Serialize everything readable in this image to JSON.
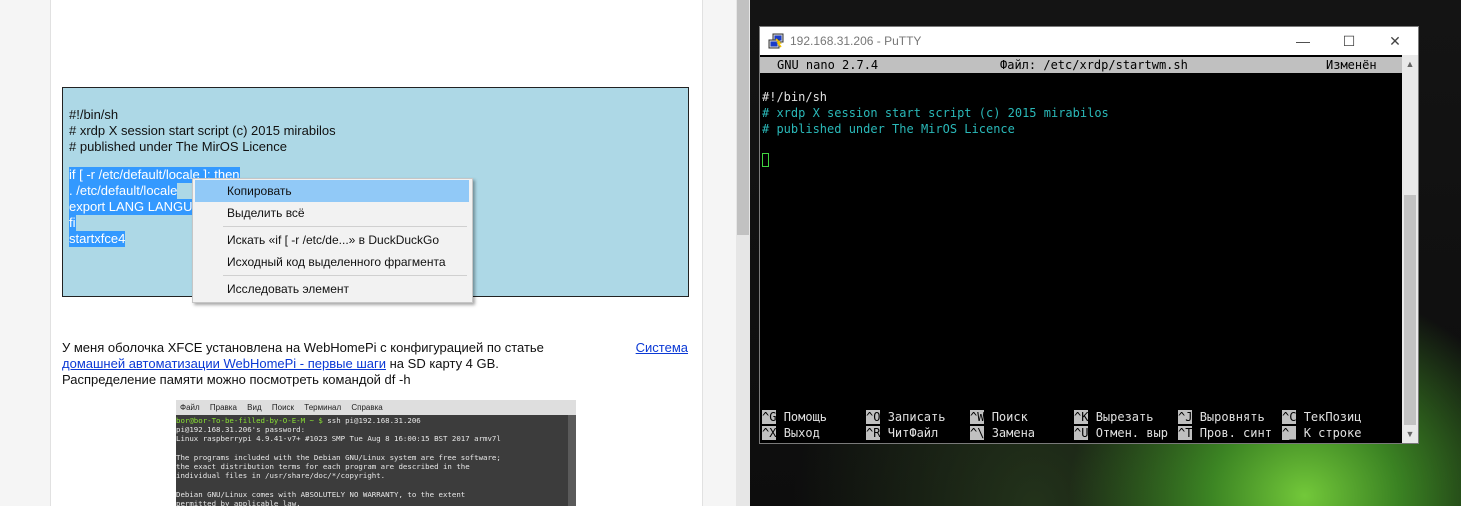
{
  "browser": {
    "code": {
      "lines": [
        "#!/bin/sh",
        "# xrdp X session start script (c) 2015 mirabilos",
        "# published under The MirOS Licence"
      ],
      "selected_lines": [
        "if [ -r /etc/default/locale ]; then",
        ". /etc/default/locale",
        "export LANG LANGUAGE",
        "fi",
        "startxfce4"
      ]
    },
    "context_menu": {
      "items": [
        "Копировать",
        "Выделить всё",
        "Искать «if [ -r /etc/de...» в DuckDuckGo",
        "Исходный код выделенного фрагмента",
        "Исследовать элемент"
      ]
    },
    "article": {
      "text1": "У меня оболочка XFCE установлена на WebHomePi с конфигурацией по статье",
      "link_a": "Система",
      "link_b": "домашней автоматизации WebHomePi - первые шаги",
      "text2": "на SD карту 4 GB.",
      "text3": "Распределение памяти можно посмотреть командой df -h"
    },
    "terminal_screenshot": {
      "menu": [
        "Файл",
        "Правка",
        "Вид",
        "Поиск",
        "Терминал",
        "Справка"
      ],
      "prompt": "bor@bor-To-be-filled-by-O-E-M ~ $",
      "command": "ssh pi@192.168.31.206",
      "lines": [
        "pi@192.168.31.206's password:",
        "Linux raspberrypi 4.9.41-v7+ #1023 SMP Tue Aug 8 16:00:15 BST 2017 armv7l",
        "",
        "The programs included with the Debian GNU/Linux system are free software;",
        "the exact distribution terms for each program are described in the",
        "individual files in /usr/share/doc/*/copyright.",
        "",
        "Debian GNU/Linux comes with ABSOLUTELY NO WARRANTY, to the extent",
        "permitted by applicable law."
      ]
    }
  },
  "putty": {
    "title": "192.168.31.206 - PuTTY",
    "buttons": {
      "minimize": "—",
      "maximize": "☐",
      "close": "✕"
    },
    "nano_header": {
      "app": "GNU nano 2.7.4",
      "file": "Файл: /etc/xrdp/startwm.sh",
      "status": "Изменён"
    },
    "file_lines": [
      "#!/bin/sh",
      "# xrdp X session start script (c) 2015 mirabilos",
      "# published under The MirOS Licence"
    ],
    "shortcuts_row1": [
      {
        "key": "^G",
        "label": "Помощь"
      },
      {
        "key": "^O",
        "label": "Записать"
      },
      {
        "key": "^W",
        "label": "Поиск"
      },
      {
        "key": "^K",
        "label": "Вырезать"
      },
      {
        "key": "^J",
        "label": "Выровнять"
      },
      {
        "key": "^C",
        "label": "ТекПозиц"
      }
    ],
    "shortcuts_row2": [
      {
        "key": "^X",
        "label": "Выход"
      },
      {
        "key": "^R",
        "label": "ЧитФайл"
      },
      {
        "key": "^\\",
        "label": "Замена"
      },
      {
        "key": "^U",
        "label": "Отмен. выр"
      },
      {
        "key": "^T",
        "label": "Пров. синт"
      },
      {
        "key": "^_",
        "label": "К строке"
      }
    ]
  }
}
